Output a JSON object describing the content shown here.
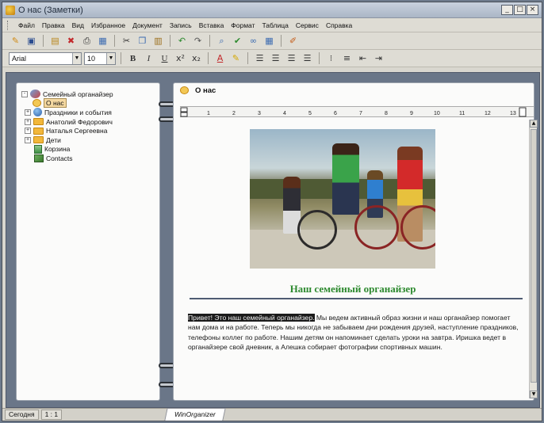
{
  "window": {
    "title": "О нас (Заметки)",
    "controls": [
      "_",
      "□",
      "×"
    ]
  },
  "menu": [
    "Файл",
    "Правка",
    "Вид",
    "Избранное",
    "Документ",
    "Запись",
    "Вставка",
    "Формат",
    "Таблица",
    "Сервис",
    "Справка"
  ],
  "toolbar": {
    "icons": [
      "new-note-icon",
      "save-icon",
      "insert-icon",
      "delete-icon",
      "print-icon",
      "print-preview-icon",
      "cut-icon",
      "copy-icon",
      "paste-icon",
      "undo-icon",
      "redo-icon",
      "find-icon",
      "spellcheck-icon",
      "link-icon",
      "table-icon",
      "brush-icon"
    ]
  },
  "format": {
    "font": "Arial",
    "size": "10",
    "bold": "B",
    "italic": "I",
    "underline": "U"
  },
  "tree": {
    "items": [
      {
        "label": "Семейный органайзер",
        "level": 0,
        "expander": "-",
        "icon": "root"
      },
      {
        "label": "О нас",
        "level": 1,
        "expander": "",
        "icon": "note",
        "selected": true
      },
      {
        "label": "Праздники и события",
        "level": 1,
        "expander": "+",
        "icon": "globe"
      },
      {
        "label": "Анатолий Федорович",
        "level": 1,
        "expander": "+",
        "icon": "folder"
      },
      {
        "label": "Наталья Сергеевна",
        "level": 1,
        "expander": "+",
        "icon": "folder"
      },
      {
        "label": "Дети",
        "level": 1,
        "expander": "+",
        "icon": "folder"
      },
      {
        "label": "Корзина",
        "level": 1,
        "expander": "",
        "icon": "trash"
      },
      {
        "label": "Contacts",
        "level": 1,
        "expander": "",
        "icon": "contacts"
      }
    ]
  },
  "note": {
    "title": "О нас",
    "ruler_marks": [
      "1",
      "2",
      "3",
      "4",
      "5",
      "6",
      "7",
      "8",
      "9",
      "10",
      "11",
      "12",
      "13"
    ],
    "heading": "Наш семейный органайзер",
    "highlight": "Привет! Это наш семейный органайзер.",
    "body": " Мы ведем активный образ жизни и наш органайзер помогает нам дома и на работе. Теперь мы никогда не забываем дни рождения друзей, наступление праздников, телефоны коллег по работе. Нашим детям он напоминает сделать уроки на завтра. Иришка ведет в органайзере свой дневник, а Алешка собирает фотографии спортивных машин."
  },
  "status": {
    "mode": "Сегодня",
    "position": "1 : 1",
    "tab": "WinOrganizer"
  },
  "colors": {
    "heading": "#2d8a2f",
    "selection": "#f5d9a2",
    "highlight_bg": "#1b1b1b"
  }
}
